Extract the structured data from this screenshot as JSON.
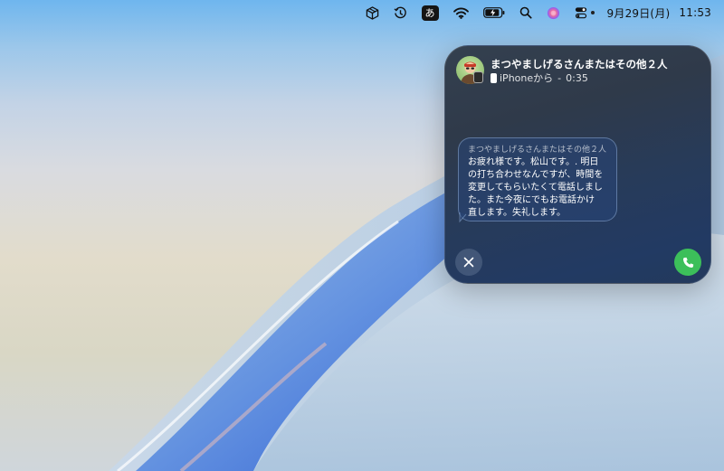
{
  "menubar": {
    "ime_label": "あ",
    "date": "9月29日(月)",
    "time": "11:53",
    "icons": [
      "package-icon",
      "clock-history-icon",
      "ime-icon",
      "wifi-icon",
      "battery-charging-icon",
      "search-icon",
      "siri-icon",
      "control-center-icon"
    ]
  },
  "call": {
    "caller_name": "まつやましげるさんまたはその他２人",
    "source": "iPhoneから",
    "separator": "-",
    "duration": "0:35"
  },
  "message": {
    "sender": "まつやましげるさんまたはその他２人",
    "lines": [
      "お疲れ様です。松山です。. 明日",
      "の打ち合わせなんですが、時間を",
      "変更してもらいたくて電話しまし",
      "た。また今夜にでもお電話かけ",
      "直します。失礼します。"
    ]
  },
  "colors": {
    "accept": "#3cbf5a",
    "panel": "#2a3b56"
  }
}
